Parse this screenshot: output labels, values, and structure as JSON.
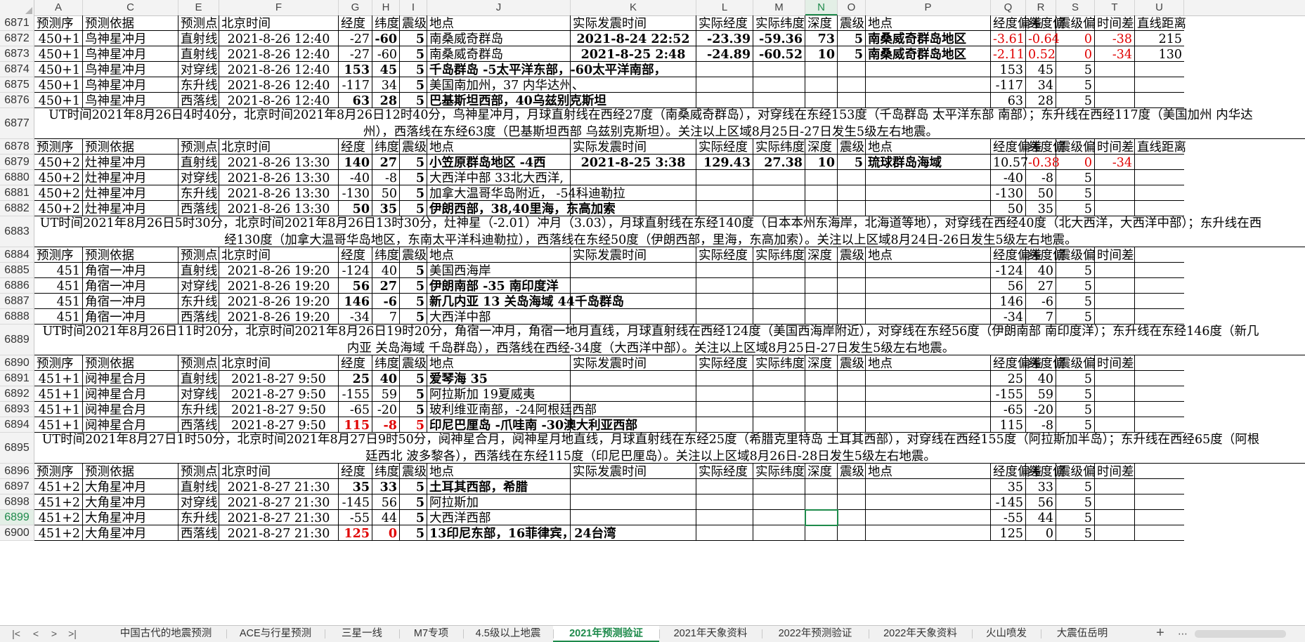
{
  "columns": [
    {
      "letter": "A",
      "w": 69
    },
    {
      "letter": "C",
      "w": 136
    },
    {
      "letter": "E",
      "w": 58
    },
    {
      "letter": "F",
      "w": 170
    },
    {
      "letter": "G",
      "w": 48
    },
    {
      "letter": "H",
      "w": 39
    },
    {
      "letter": "I",
      "w": 39
    },
    {
      "letter": "J",
      "w": 204
    },
    {
      "letter": "K",
      "w": 179
    },
    {
      "letter": "L",
      "w": 81
    },
    {
      "letter": "M",
      "w": 74
    },
    {
      "letter": "N",
      "w": 46
    },
    {
      "letter": "O",
      "w": 40
    },
    {
      "letter": "P",
      "w": 178
    },
    {
      "letter": "Q",
      "w": 50
    },
    {
      "letter": "R",
      "w": 43
    },
    {
      "letter": "S",
      "w": 55
    },
    {
      "letter": "T",
      "w": 57
    },
    {
      "letter": "U",
      "w": 70
    }
  ],
  "selected_column": "N",
  "selected_row": "6899",
  "rows": [
    {
      "n": "6871",
      "type": "header",
      "cells": [
        "预测序",
        "预测依据",
        "预测点",
        "北京时间",
        "经度",
        "纬度",
        "震级",
        "地点",
        "实际发震时间",
        "实际经度",
        "实际纬度",
        "深度",
        "震级",
        "地点",
        "经度偏差",
        "纬度偏",
        "震级偏",
        "时间差",
        "直线距离"
      ]
    },
    {
      "n": "6872",
      "type": "data",
      "cells": [
        "450+1",
        "鸟神星冲月",
        "直射线",
        "2021-8-26 12:40",
        "-27",
        "-60",
        "5",
        "南桑威奇群岛",
        "2021-8-24 22:52",
        "-23.39",
        "-59.36",
        "73",
        "5",
        "南桑威奇群岛地区",
        "-3.61",
        "-0.64",
        "0",
        "-38",
        "215"
      ],
      "bold": [
        5,
        6,
        8,
        9,
        10,
        11,
        12,
        13
      ],
      "red": [
        14,
        15,
        16,
        17
      ]
    },
    {
      "n": "6873",
      "type": "data",
      "cells": [
        "450+1",
        "鸟神星冲月",
        "直射线",
        "2021-8-26 12:40",
        "-27",
        "-60",
        "5",
        "南桑威奇群岛",
        "2021-8-25 2:48",
        "-24.89",
        "-60.52",
        "10",
        "5",
        "南桑威奇群岛地区",
        "-2.11",
        "0.52",
        "0",
        "-34",
        "130"
      ],
      "bold": [
        6,
        8,
        9,
        10,
        11,
        12,
        13
      ],
      "red": [
        14,
        15,
        16,
        17
      ]
    },
    {
      "n": "6874",
      "type": "data",
      "cells": [
        "450+1",
        "鸟神星冲月",
        "对穿线",
        "2021-8-26 12:40",
        "153",
        "45",
        "5",
        "千岛群岛 -5太平洋东部，-60太平洋南部，",
        "",
        "",
        "",
        "",
        "",
        "",
        "153",
        "45",
        "5",
        "",
        ""
      ],
      "bold": [
        4,
        5,
        6,
        7
      ]
    },
    {
      "n": "6875",
      "type": "data",
      "cells": [
        "450+1",
        "鸟神星冲月",
        "东升线",
        "2021-8-26 12:40",
        "-117",
        "34",
        "5",
        "美国南加州，37 内华达州、",
        "",
        "",
        "",
        "",
        "",
        "",
        "-117",
        "34",
        "5",
        "",
        ""
      ],
      "bold": [
        6
      ]
    },
    {
      "n": "6876",
      "type": "data",
      "cells": [
        "450+1",
        "鸟神星冲月",
        "西落线",
        "2021-8-26 12:40",
        "63",
        "28",
        "5",
        "巴基斯坦西部，40乌兹别克斯坦",
        "",
        "",
        "",
        "",
        "",
        "",
        "63",
        "28",
        "5",
        "",
        ""
      ],
      "bold": [
        4,
        5,
        6,
        7
      ]
    },
    {
      "n": "6877",
      "type": "note",
      "h": 44,
      "text": "UT时间2021年8月26日4时40分，北京时间2021年8月26日12时40分，鸟神星冲月，月球直射线在西经27度（南桑威奇群岛），对穿线在东经153度（千岛群岛 太平洋东部 南部）；东升线在西经117度（美国加州 内华达州），西落线在东经63度（巴基斯坦西部 乌兹别克斯坦）。关注以上区域8月25日-27日发生5级左右地震。"
    },
    {
      "n": "6878",
      "type": "header",
      "cells": [
        "预测序",
        "预测依据",
        "预测点",
        "北京时间",
        "经度",
        "纬度",
        "震级",
        "地点",
        "实际发震时间",
        "实际经度",
        "实际纬度",
        "深度",
        "震级",
        "地点",
        "经度偏差",
        "纬度偏",
        "震级偏",
        "时间差",
        "直线距离"
      ]
    },
    {
      "n": "6879",
      "type": "data",
      "cells": [
        "450+2",
        "灶神星冲月",
        "直射线",
        "2021-8-26 13:30",
        "140",
        "27",
        "5",
        "小笠原群岛地区 -4西",
        "2021-8-25 3:38",
        "129.43",
        "27.38",
        "10",
        "5",
        "琉球群岛海域",
        "10.57",
        "-0.38",
        "0",
        "-34",
        ""
      ],
      "bold": [
        4,
        5,
        6,
        7,
        8,
        9,
        10,
        11,
        12,
        13
      ],
      "red": [
        15,
        16,
        17
      ],
      "clip": [
        7
      ]
    },
    {
      "n": "6880",
      "type": "data",
      "cells": [
        "450+2",
        "灶神星冲月",
        "对穿线",
        "2021-8-26 13:30",
        "-40",
        "-8",
        "5",
        "大西洋中部 33北大西洋,",
        "",
        "",
        "",
        "",
        "",
        "",
        "-40",
        "-8",
        "5",
        "",
        ""
      ],
      "bold": [
        6
      ]
    },
    {
      "n": "6881",
      "type": "data",
      "cells": [
        "450+2",
        "灶神星冲月",
        "东升线",
        "2021-8-26 13:30",
        "-130",
        "50",
        "5",
        "加拿大温哥华岛附近，  -54科迪勒拉",
        "",
        "",
        "",
        "",
        "",
        "",
        "-130",
        "50",
        "5",
        "",
        ""
      ],
      "bold": [
        6
      ]
    },
    {
      "n": "6882",
      "type": "data",
      "cells": [
        "450+2",
        "灶神星冲月",
        "西落线",
        "2021-8-26 13:30",
        "50",
        "35",
        "5",
        "伊朗西部，38,40里海，东高加索",
        "",
        "",
        "",
        "",
        "",
        "",
        "50",
        "35",
        "5",
        "",
        ""
      ],
      "bold": [
        4,
        5,
        6,
        7
      ]
    },
    {
      "n": "6883",
      "type": "note",
      "h": 44,
      "text": "UT时间2021年8月26日5时30分，北京时间2021年8月26日13时30分，灶神星（-2.01）冲月（3.03），月球直射线在东经140度（日本本州东海岸，北海道等地），对穿线在西经40度（北大西洋，大西洋中部）；东升线在西经130度（加拿大温哥华岛地区，东南太平洋科迪勒拉），西落线在东经50度（伊朗西部，里海，东高加索）。关注以上区域8月24日-26日发生5级左右地震。"
    },
    {
      "n": "6884",
      "type": "header",
      "cells": [
        "预测序",
        "预测依据",
        "预测点",
        "北京时间",
        "经度",
        "纬度",
        "震级",
        "地点",
        "实际发震时间",
        "实际经度",
        "实际纬度",
        "深度",
        "震级",
        "地点",
        "经度偏差",
        "纬度偏",
        "震级偏",
        "时间差",
        ""
      ]
    },
    {
      "n": "6885",
      "type": "data",
      "cells": [
        "451",
        "角宿一冲月",
        "直射线",
        "2021-8-26 19:20",
        "-124",
        "40",
        "5",
        "美国西海岸",
        "",
        "",
        "",
        "",
        "",
        "",
        "-124",
        "40",
        "5",
        "",
        ""
      ],
      "bold": [
        6
      ]
    },
    {
      "n": "6886",
      "type": "data",
      "cells": [
        "451",
        "角宿一冲月",
        "对穿线",
        "2021-8-26 19:20",
        "56",
        "27",
        "5",
        "伊朗南部 -35 南印度洋",
        "",
        "",
        "",
        "",
        "",
        "",
        "56",
        "27",
        "5",
        "",
        ""
      ],
      "bold": [
        4,
        5,
        6,
        7
      ]
    },
    {
      "n": "6887",
      "type": "data",
      "cells": [
        "451",
        "角宿一冲月",
        "东升线",
        "2021-8-26 19:20",
        "146",
        "-6",
        "5",
        "新几内亚 13 关岛海域 44千岛群岛",
        "",
        "",
        "",
        "",
        "",
        "",
        "146",
        "-6",
        "5",
        "",
        ""
      ],
      "bold": [
        4,
        5,
        6,
        7
      ]
    },
    {
      "n": "6888",
      "type": "data",
      "cells": [
        "451",
        "角宿一冲月",
        "西落线",
        "2021-8-26 19:20",
        "-34",
        "7",
        "5",
        "大西洋中部",
        "",
        "",
        "",
        "",
        "",
        "",
        "-34",
        "7",
        "5",
        "",
        ""
      ],
      "bold": [
        6
      ]
    },
    {
      "n": "6889",
      "type": "note",
      "h": 44,
      "text": "UT时间2021年8月26日11时20分，北京时间2021年8月26日19时20分，角宿一冲月，角宿一地月直线，月球直射线在西经124度（美国西海岸附近），对穿线在东经56度（伊朗南部 南印度洋）；东升线在东经146度（新几内亚 关岛海域 千岛群岛），西落线在西经-34度（大西洋中部）。关注以上区域8月25日-27日发生5级左右地震。"
    },
    {
      "n": "6890",
      "type": "header",
      "cells": [
        "预测序",
        "预测依据",
        "预测点",
        "北京时间",
        "经度",
        "纬度",
        "震级",
        "地点",
        "实际发震时间",
        "实际经度",
        "实际纬度",
        "深度",
        "震级",
        "地点",
        "经度偏差",
        "纬度偏",
        "震级偏",
        "时间差",
        ""
      ]
    },
    {
      "n": "6891",
      "type": "data",
      "cells": [
        "451+1",
        "阋神星合月",
        "直射线",
        "2021-8-27 9:50",
        "25",
        "40",
        "5",
        "爱琴海 35",
        "",
        "",
        "",
        "",
        "",
        "",
        "25",
        "40",
        "5",
        "",
        ""
      ],
      "bold": [
        4,
        5,
        6,
        7
      ]
    },
    {
      "n": "6892",
      "type": "data",
      "cells": [
        "451+1",
        "阋神星合月",
        "对穿线",
        "2021-8-27 9:50",
        "-155",
        "59",
        "5",
        "阿拉斯加 19夏威夷",
        "",
        "",
        "",
        "",
        "",
        "",
        "-155",
        "59",
        "5",
        "",
        ""
      ],
      "bold": [
        6
      ]
    },
    {
      "n": "6893",
      "type": "data",
      "cells": [
        "451+1",
        "阋神星合月",
        "东升线",
        "2021-8-27 9:50",
        "-65",
        "-20",
        "5",
        "玻利维亚南部，-24阿根廷西部",
        "",
        "",
        "",
        "",
        "",
        "",
        "-65",
        "-20",
        "5",
        "",
        ""
      ],
      "bold": [
        6
      ]
    },
    {
      "n": "6894",
      "type": "data",
      "cells": [
        "451+1",
        "阋神星合月",
        "西落线",
        "2021-8-27 9:50",
        "115",
        "-8",
        "5",
        "印尼巴厘岛 -爪哇南 -30澳大利亚西部",
        "",
        "",
        "",
        "",
        "",
        "",
        "115",
        "-8",
        "5",
        "",
        ""
      ],
      "bold": [
        4,
        5,
        6,
        7
      ],
      "red": [
        4,
        5,
        6
      ]
    },
    {
      "n": "6895",
      "type": "note",
      "h": 44,
      "text": "UT时间2021年8月27日1时50分，北京时间2021年8月27日9时50分，阋神星合月，阋神星月地直线，月球直射线在东经25度（希腊克里特岛 土耳其西部），对穿线在西经155度（阿拉斯加半岛）；东升线在西经65度（阿根廷西北 波多黎各），西落线在东经115度（印尼巴厘岛）。关注以上区域8月26日-28日发生5级左右地震。"
    },
    {
      "n": "6896",
      "type": "header",
      "cells": [
        "预测序",
        "预测依据",
        "预测点",
        "北京时间",
        "经度",
        "纬度",
        "震级",
        "地点",
        "实际发震时间",
        "实际经度",
        "实际纬度",
        "深度",
        "震级",
        "地点",
        "经度偏差",
        "纬度偏",
        "震级偏",
        "时间差",
        ""
      ]
    },
    {
      "n": "6897",
      "type": "data",
      "cells": [
        "451+2",
        "大角星冲月",
        "直射线",
        "2021-8-27 21:30",
        "35",
        "33",
        "5",
        "土耳其西部，希腊",
        "",
        "",
        "",
        "",
        "",
        "",
        "35",
        "33",
        "5",
        "",
        ""
      ],
      "bold": [
        4,
        5,
        6,
        7
      ]
    },
    {
      "n": "6898",
      "type": "data",
      "cells": [
        "451+2",
        "大角星冲月",
        "对穿线",
        "2021-8-27 21:30",
        "-145",
        "56",
        "5",
        "阿拉斯加",
        "",
        "",
        "",
        "",
        "",
        "",
        "-145",
        "56",
        "5",
        "",
        ""
      ],
      "bold": [
        6
      ]
    },
    {
      "n": "6899",
      "type": "data",
      "cells": [
        "451+2",
        "大角星冲月",
        "东升线",
        "2021-8-27 21:30",
        "-55",
        "44",
        "5",
        "大西洋西部",
        "",
        "",
        "",
        "",
        "",
        "",
        "-55",
        "44",
        "5",
        "",
        ""
      ],
      "bold": [
        6
      ]
    },
    {
      "n": "6900",
      "type": "data",
      "cells": [
        "451+2",
        "大角星冲月",
        "西落线",
        "2021-8-27 21:30",
        "125",
        "0",
        "5",
        "13印尼东部，16菲律宾，24台湾",
        "",
        "",
        "",
        "",
        "",
        "",
        "125",
        "0",
        "5",
        "",
        ""
      ],
      "bold": [
        4,
        5,
        6,
        7
      ],
      "red": [
        4,
        5
      ]
    }
  ],
  "tabs": [
    "中国古代的地震预测",
    "ACE与行星预测",
    "三星一线",
    "M7专项",
    "4.5级以上地震",
    "2021年预测验证",
    "2021年天象资料",
    "2022年预测验证",
    "2022年天象资料",
    "火山喷发",
    "大震伍岳明"
  ],
  "active_tab": "2021年预测验证",
  "nav": {
    "first": "|<",
    "prev": "<",
    "next": ">",
    "last": ">|",
    "add": "+",
    "more": "⋯"
  }
}
